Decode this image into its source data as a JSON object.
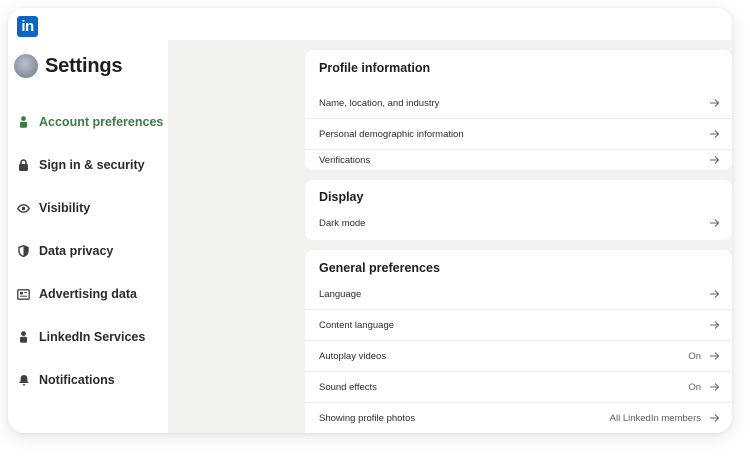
{
  "app": {
    "logo_text": "in"
  },
  "sidebar": {
    "title": "Settings",
    "items": [
      {
        "label": "Account preferences",
        "icon": "person-icon",
        "active": true
      },
      {
        "label": "Sign in & security",
        "icon": "lock-icon",
        "active": false
      },
      {
        "label": "Visibility",
        "icon": "eye-icon",
        "active": false
      },
      {
        "label": "Data privacy",
        "icon": "shield-icon",
        "active": false
      },
      {
        "label": "Advertising data",
        "icon": "newspaper-icon",
        "active": false
      },
      {
        "label": "LinkedIn Services",
        "icon": "person-icon",
        "active": false
      },
      {
        "label": "Notifications",
        "icon": "bell-icon",
        "active": false
      }
    ]
  },
  "sections": [
    {
      "title": "Profile information",
      "rows": [
        {
          "label": "Name, location, and industry",
          "value": ""
        },
        {
          "label": "Personal demographic information",
          "value": ""
        },
        {
          "label": "Verifications",
          "value": ""
        }
      ]
    },
    {
      "title": "Display",
      "rows": [
        {
          "label": "Dark mode",
          "value": ""
        }
      ]
    },
    {
      "title": "General preferences",
      "rows": [
        {
          "label": "Language",
          "value": ""
        },
        {
          "label": "Content language",
          "value": ""
        },
        {
          "label": "Autoplay videos",
          "value": "On"
        },
        {
          "label": "Sound effects",
          "value": "On"
        },
        {
          "label": "Showing profile photos",
          "value": "All LinkedIn members"
        }
      ]
    }
  ],
  "colors": {
    "brand": "#0a66c2",
    "active_nav": "#3f7c44",
    "page_background": "#f4f2ee"
  }
}
